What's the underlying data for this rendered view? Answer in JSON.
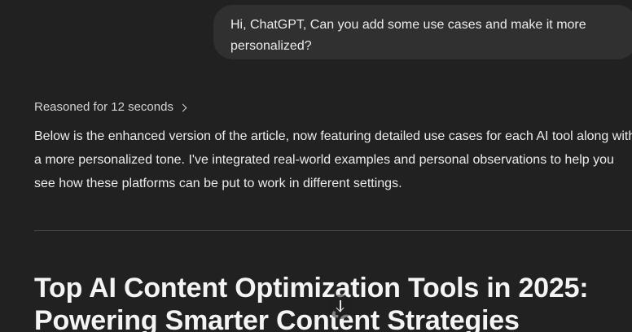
{
  "conversation": {
    "user_message": {
      "lines": [
        "Hi, ChatGPT, Can you add some use cases and make it more",
        "personalized?"
      ]
    },
    "assistant": {
      "reasoning_label": "Reasoned for 12 seconds",
      "intro_lines": [
        "Below is the enhanced version of the article, now featuring detailed use cases for each AI tool along with",
        "a more personalized tone. I've integrated real-world examples and personal observations to help you",
        "see how these platforms can be put to work in different settings."
      ],
      "article_title_lines": [
        "Top AI Content Optimization Tools in 2025:",
        "Powering Smarter Content Strategies"
      ]
    }
  },
  "controls": {
    "scroll_down_icon": "arrow-down-icon"
  },
  "colors": {
    "background": "#212121",
    "user_bubble": "#303030",
    "text": "#ececec",
    "divider": "#4a4a4a"
  }
}
